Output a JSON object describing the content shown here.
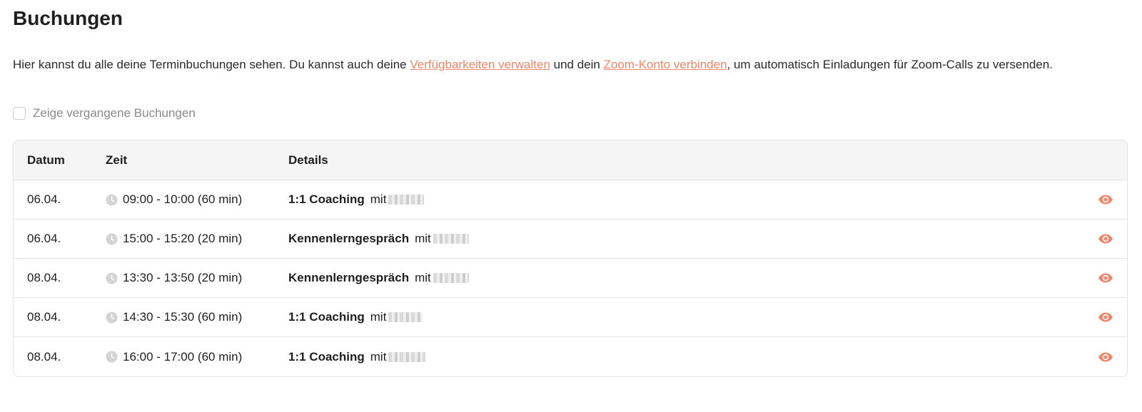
{
  "page": {
    "title": "Buchungen",
    "intro_text_1": "Hier kannst du alle deine Terminbuchungen sehen. Du kannst auch deine ",
    "intro_link_1": "Verfügbarkeiten verwalten",
    "intro_text_2": " und dein ",
    "intro_link_2": "Zoom-Konto verbinden",
    "intro_text_3": ", um automatisch Einladungen für Zoom-Calls zu versenden.",
    "accent_color": "#f0866a"
  },
  "filter": {
    "show_past_label": "Zeige vergangene Buchungen",
    "show_past_checked": false
  },
  "table": {
    "headers": {
      "date": "Datum",
      "time": "Zeit",
      "details": "Details"
    },
    "rows": [
      {
        "date": "06.04.",
        "time": "09:00 - 10:00 (60 min)",
        "event": "1:1 Coaching",
        "with": "mit"
      },
      {
        "date": "06.04.",
        "time": "15:00 - 15:20 (20 min)",
        "event": "Kennenlerngespräch",
        "with": "mit"
      },
      {
        "date": "08.04.",
        "time": "13:30 - 13:50 (20 min)",
        "event": "Kennenlerngespräch",
        "with": "mit"
      },
      {
        "date": "08.04.",
        "time": "14:30 - 15:30 (60 min)",
        "event": "1:1 Coaching",
        "with": "mit"
      },
      {
        "date": "08.04.",
        "time": "16:00 - 17:00 (60 min)",
        "event": "1:1 Coaching",
        "with": "mit"
      }
    ],
    "row_icons": {
      "time": "clock-icon",
      "action": "eye-icon"
    }
  }
}
